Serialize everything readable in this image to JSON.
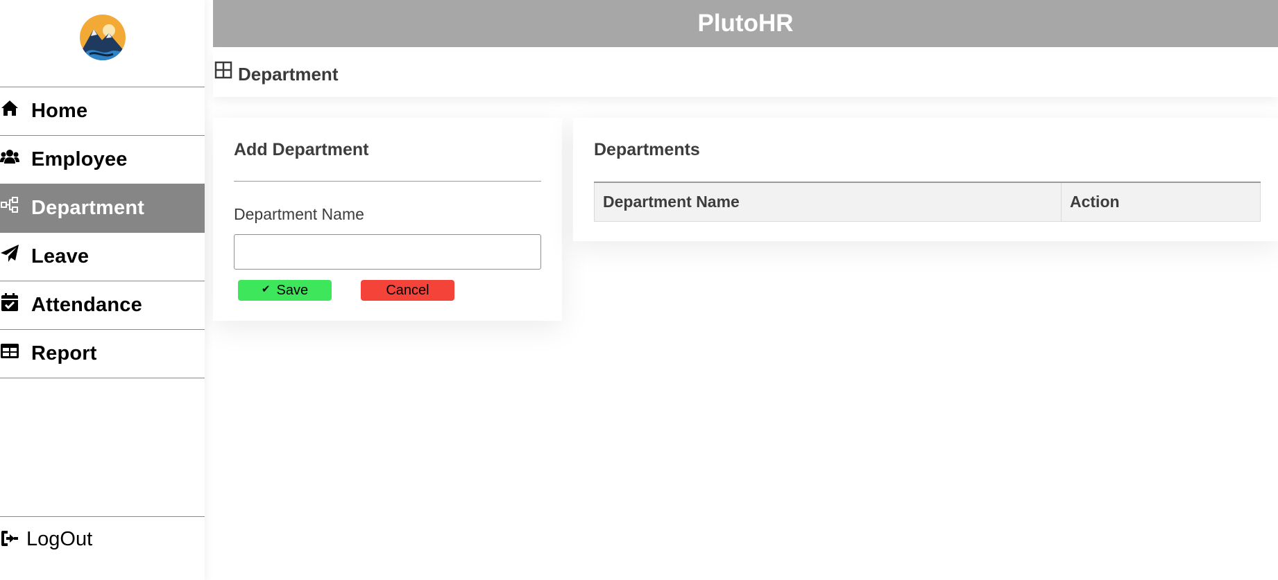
{
  "app": {
    "title": "PlutoHR"
  },
  "sidebar": {
    "logo_icon": "mountain-sunset-logo",
    "items": [
      {
        "label": "Home",
        "icon": "home-icon",
        "active": false
      },
      {
        "label": "Employee",
        "icon": "users-icon",
        "active": false
      },
      {
        "label": "Department",
        "icon": "sitemap-icon",
        "active": true
      },
      {
        "label": "Leave",
        "icon": "paper-plane-icon",
        "active": false
      },
      {
        "label": "Attendance",
        "icon": "calendar-check-icon",
        "active": false
      },
      {
        "label": "Report",
        "icon": "table-icon",
        "active": false
      }
    ],
    "logout_label": "LogOut",
    "logout_icon": "sign-out-icon"
  },
  "page": {
    "title": "Department",
    "title_icon": "grid-icon"
  },
  "add_form": {
    "title": "Add Department",
    "field_label": "Department Name",
    "field_value": "",
    "save_label": "Save",
    "save_icon": "check-icon",
    "cancel_label": "Cancel"
  },
  "departments": {
    "title": "Departments",
    "columns": [
      "Department Name",
      "Action"
    ],
    "rows": []
  },
  "colors": {
    "header_bg": "#a8a7a8",
    "active_nav_bg": "#868686",
    "save_bg": "#3ee65c",
    "cancel_bg": "#f4443a"
  }
}
